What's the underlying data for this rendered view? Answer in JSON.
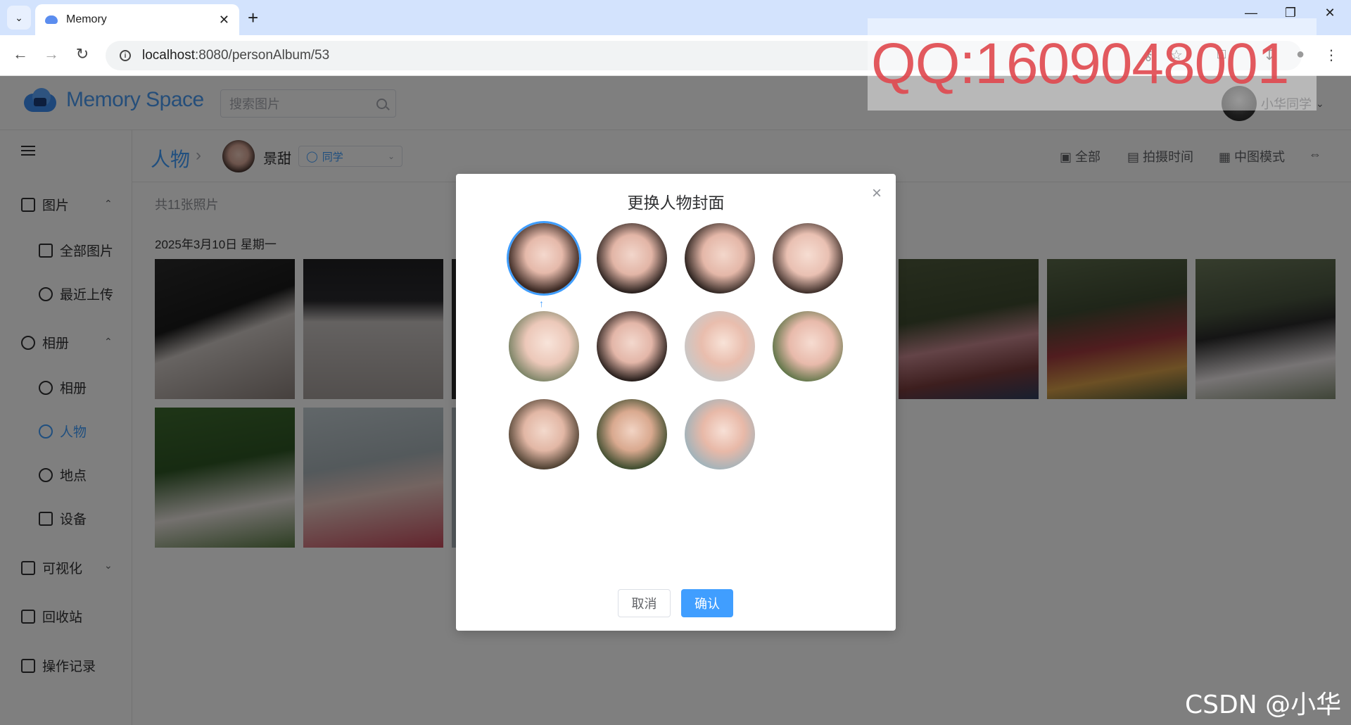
{
  "browser": {
    "tab_title": "Memory",
    "new_tab_symbol": "+",
    "url_host": "localhost",
    "url_path": ":8080/personAlbum/53"
  },
  "app": {
    "logo_text": "Memory Space",
    "search_placeholder": "搜索图片",
    "user_name": "小华同学"
  },
  "sidebar": {
    "items": [
      {
        "label": "图片",
        "expanded": true
      },
      {
        "label": "全部图片"
      },
      {
        "label": "最近上传"
      },
      {
        "label": "相册",
        "expanded": true
      },
      {
        "label": "相册"
      },
      {
        "label": "人物",
        "active": true
      },
      {
        "label": "地点"
      },
      {
        "label": "设备"
      },
      {
        "label": "可视化",
        "expanded": false
      },
      {
        "label": "回收站"
      },
      {
        "label": "操作记录"
      }
    ]
  },
  "breadcrumb": {
    "root": "人物",
    "person_name": "景甜",
    "relation_tag": "同学"
  },
  "toolbar": {
    "filter_all": "全部",
    "sort_time": "拍摄时间",
    "view_mode": "中图模式"
  },
  "content": {
    "count_text": "共11张照片",
    "date_group": "2025年3月10日 星期一"
  },
  "dialog": {
    "title": "更换人物封面",
    "cancel_label": "取消",
    "confirm_label": "确认",
    "cover_count": 11,
    "selected_index": 0
  },
  "overlay": {
    "watermark": "QQ:1609048001",
    "csdn": "CSDN @小华y"
  },
  "colors": {
    "accent": "#409eff",
    "watermark": "#e0484e"
  }
}
